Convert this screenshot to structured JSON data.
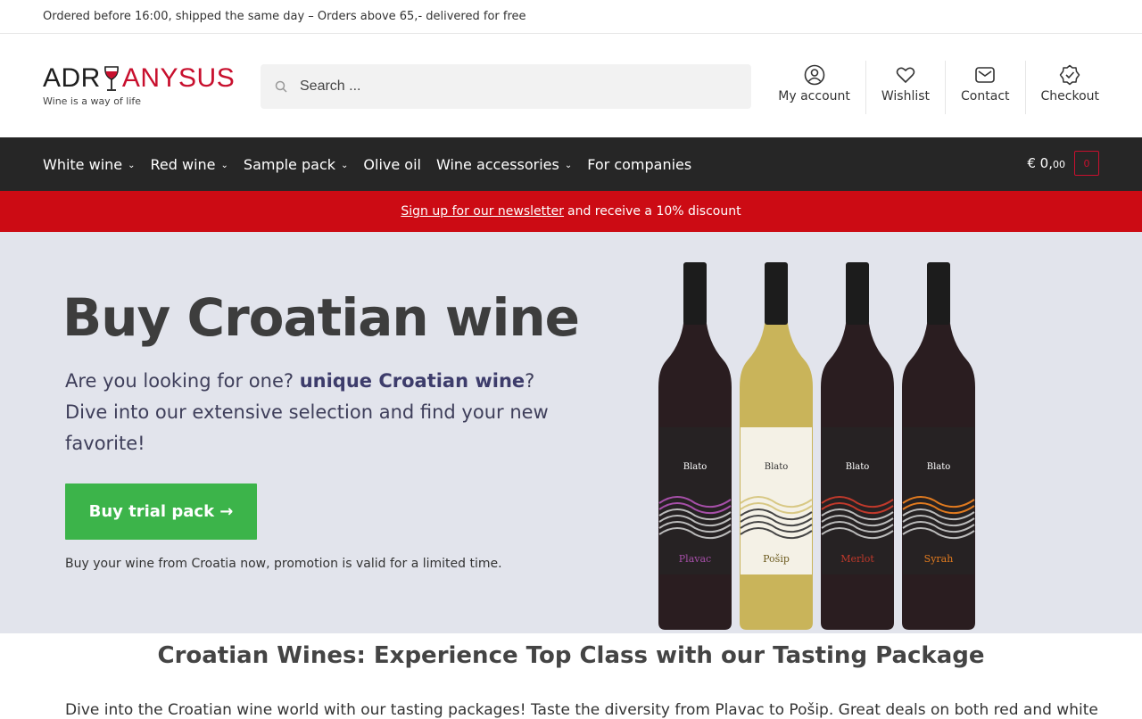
{
  "topbar": {
    "text": "Ordered before 16:00, shipped the same day – Orders above 65,- delivered for free"
  },
  "logo": {
    "part1": "ADR",
    "part2": "ANYSUS",
    "tagline": "Wine is a way of life"
  },
  "search": {
    "placeholder": "Search ..."
  },
  "header_links": [
    {
      "label": "My account",
      "icon": "user-icon"
    },
    {
      "label": "Wishlist",
      "icon": "heart-icon"
    },
    {
      "label": "Contact",
      "icon": "mail-icon"
    },
    {
      "label": "Checkout",
      "icon": "check-badge-icon"
    }
  ],
  "nav": {
    "items": [
      {
        "label": "White wine",
        "has_dropdown": true
      },
      {
        "label": "Red wine",
        "has_dropdown": true
      },
      {
        "label": "Sample pack",
        "has_dropdown": true
      },
      {
        "label": "Olive oil",
        "has_dropdown": false
      },
      {
        "label": "Wine accessories",
        "has_dropdown": true
      },
      {
        "label": "For companies",
        "has_dropdown": false
      }
    ],
    "cart_total_main": "€ 0,",
    "cart_total_cents": "00",
    "cart_count": "0"
  },
  "promo": {
    "link": "Sign up for our newsletter",
    "text": "and receive a 10% discount"
  },
  "hero": {
    "title": "Buy Croatian wine",
    "intro_before": "Are you looking for one? ",
    "intro_strong": "unique Croatian wine",
    "intro_after": "? Dive into our extensive selection and find your new favorite!",
    "button": "Buy trial pack →",
    "note": "Buy your wine from Croatia now, promotion is valid for a limited time.",
    "bottles": [
      {
        "brand": "Blato",
        "name": "Plavac",
        "color": "#2a1d20",
        "accent": "#a64fa8"
      },
      {
        "brand": "Blato",
        "name": "Pošip",
        "color": "#c9b45a",
        "accent": "#d8c884"
      },
      {
        "brand": "Blato",
        "name": "Merlot",
        "color": "#2a1d20",
        "accent": "#c0392b"
      },
      {
        "brand": "Blato",
        "name": "Syrah",
        "color": "#2a1d20",
        "accent": "#e07a1f"
      }
    ]
  },
  "section": {
    "title": "Croatian Wines: Experience Top Class with our Tasting Package",
    "text": "Dive into the Croatian wine world with our tasting packages! Taste the diversity from Plavac to Pošip. Great deals on both red and white"
  },
  "colors": {
    "brand_red": "#c8102e",
    "nav_bg": "#262626",
    "promo_bg": "#cc0b14",
    "hero_bg": "#e2e4ec",
    "button_green": "#3cb44a"
  }
}
